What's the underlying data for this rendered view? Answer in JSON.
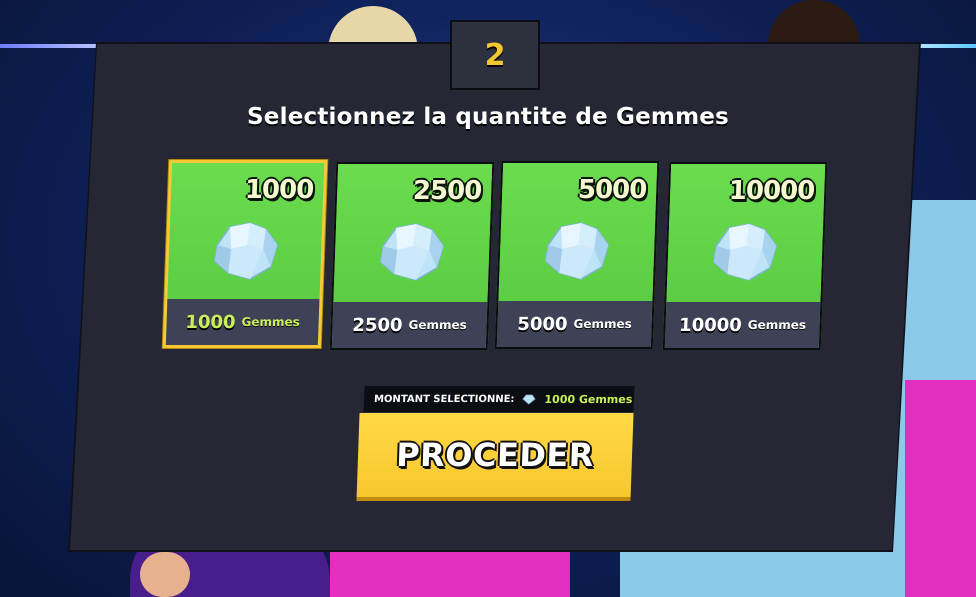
{
  "step": {
    "number": "2"
  },
  "title": "Selectionnez la quantite de Gemmes",
  "packs": [
    {
      "amount": "1000",
      "bottom_amount": "1000",
      "unit": "Gemmes",
      "selected": true
    },
    {
      "amount": "2500",
      "bottom_amount": "2500",
      "unit": "Gemmes",
      "selected": false
    },
    {
      "amount": "5000",
      "bottom_amount": "5000",
      "unit": "Gemmes",
      "selected": false
    },
    {
      "amount": "10000",
      "bottom_amount": "10000",
      "unit": "Gemmes",
      "selected": false
    }
  ],
  "selection": {
    "label": "MONTANT SELECTIONNE:",
    "value": "1000 Gemmes"
  },
  "proceed_label": "PROCEDER",
  "colors": {
    "panel": "#252734",
    "card_green": "#5fd046",
    "card_bar": "#3f4257",
    "accent_yellow": "#f7c936",
    "selected_text": "#c9f05a"
  },
  "icons": {
    "gem": "gem-icon",
    "mini_gem": "gem-icon"
  }
}
